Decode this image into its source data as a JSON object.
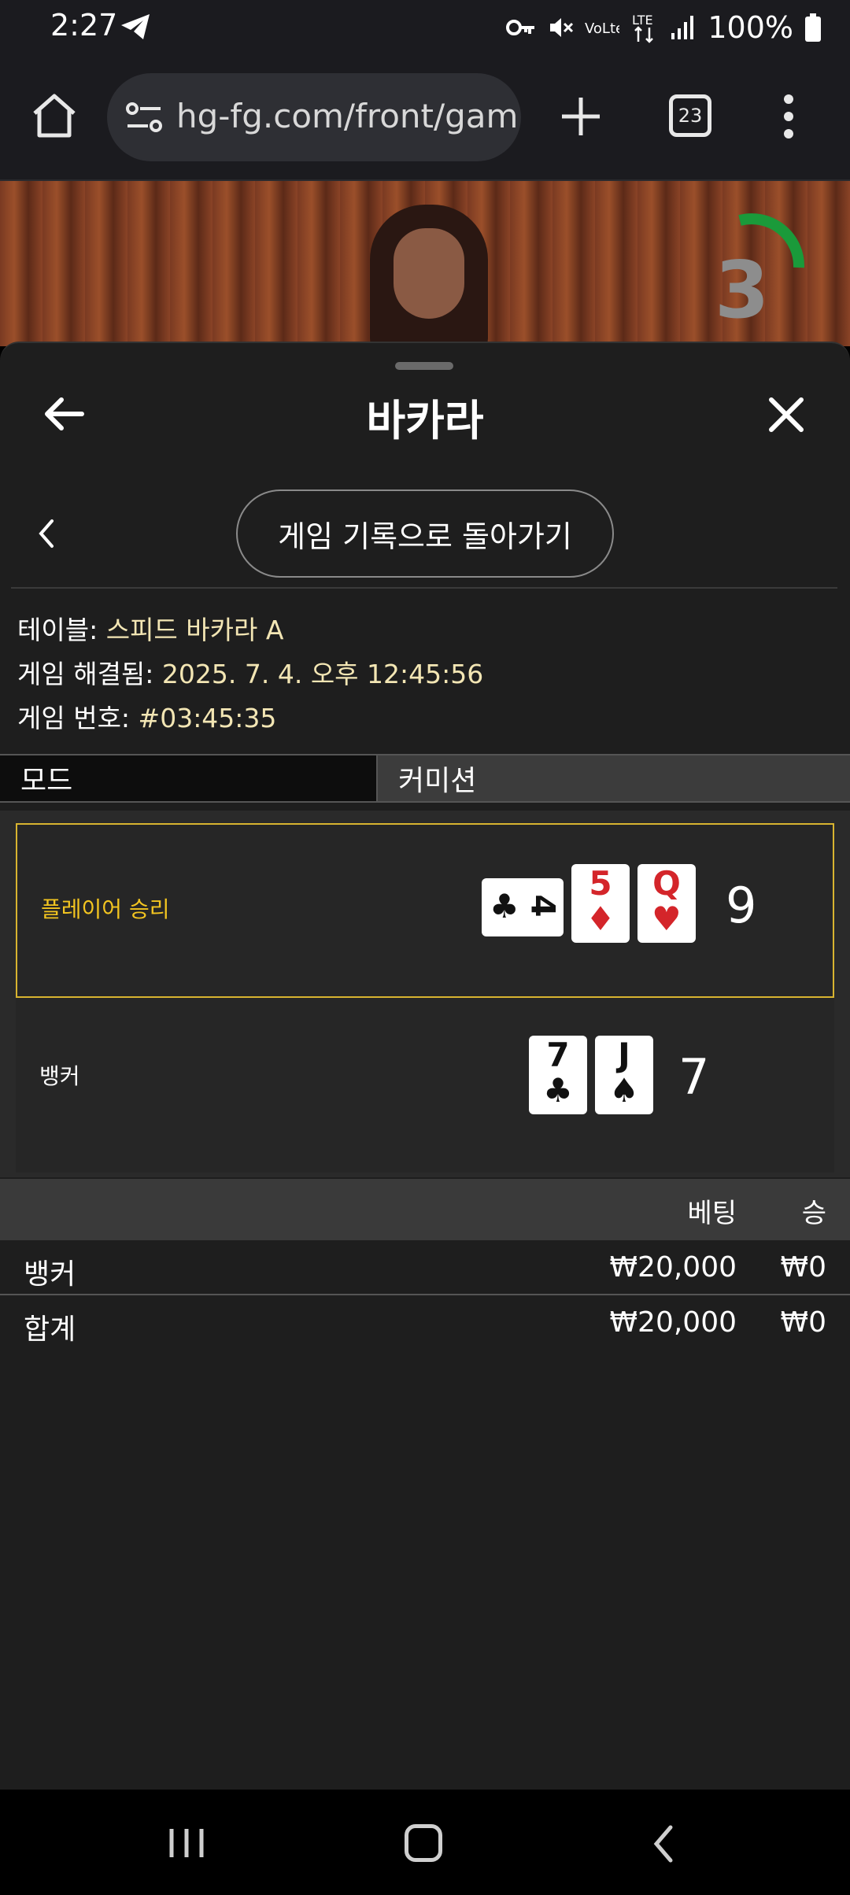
{
  "status_bar": {
    "time": "2:27",
    "battery": "100%"
  },
  "browser": {
    "url": "hg-fg.com/front/gam",
    "tab_count": "23"
  },
  "video": {
    "countdown": "3"
  },
  "panel": {
    "title": "바카라",
    "history_button": "게임 기록으로 돌아가기",
    "info": {
      "table_label": "테이블: ",
      "table_value": "스피드 바카라 A",
      "resolved_label": "게임 해결됨: ",
      "resolved_value": "2025. 7. 4. 오후 12:45:56",
      "number_label": "게임 번호: ",
      "number_value": "#03:45:35"
    },
    "tabs": {
      "mode": "모드",
      "commission": "커미션"
    },
    "results": {
      "player": {
        "label": "플레이어 승리",
        "score": "9",
        "cards": [
          {
            "rank": "4",
            "suit": "♣",
            "color": "#111111"
          },
          {
            "rank": "5",
            "suit": "♦",
            "color": "#d4252a"
          },
          {
            "rank": "Q",
            "suit": "♥",
            "color": "#d4252a"
          }
        ]
      },
      "banker": {
        "label": "뱅커",
        "score": "7",
        "cards": [
          {
            "rank": "7",
            "suit": "♣",
            "color": "#111111"
          },
          {
            "rank": "J",
            "suit": "♠",
            "color": "#111111"
          }
        ]
      }
    },
    "bets": {
      "header_bet": "베팅",
      "header_win": "승",
      "rows": [
        {
          "name": "뱅커",
          "amount": "₩20,000",
          "win": "₩0"
        },
        {
          "name": "합계",
          "amount": "₩20,000",
          "win": "₩0"
        }
      ]
    }
  },
  "colors": {
    "accent": "#f3c520",
    "panel_bg": "#1e1e1e",
    "value_text": "#f3e6b4"
  }
}
